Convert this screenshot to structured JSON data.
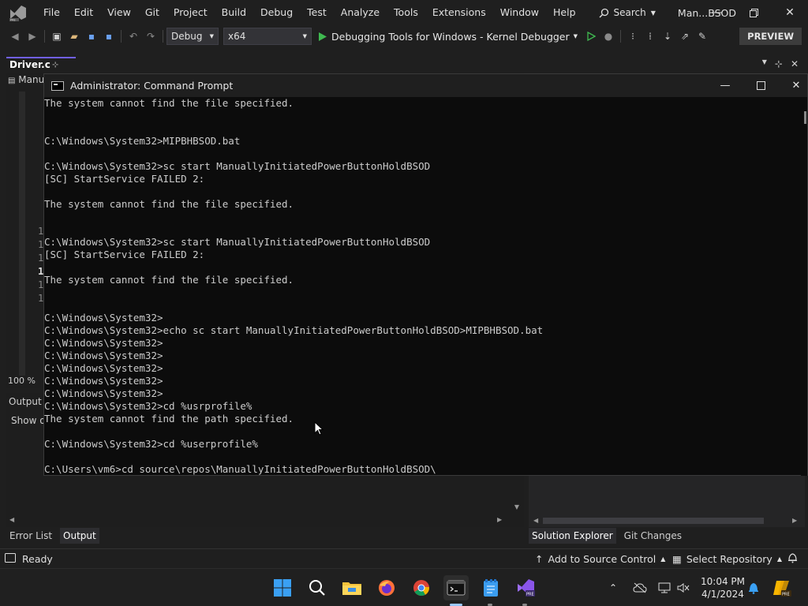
{
  "vs": {
    "menu": [
      "File",
      "Edit",
      "View",
      "Git",
      "Project",
      "Build",
      "Debug",
      "Test",
      "Analyze",
      "Tools",
      "Extensions",
      "Window",
      "Help"
    ],
    "search_label": "Search",
    "title": "Man...BSOD",
    "config": "Debug",
    "platform": "x64",
    "debug_target": "Debugging Tools for Windows - Kernel Debugger",
    "preview_label": "PREVIEW",
    "doc_tab": "Driver.c",
    "doc_subtab": "Manu",
    "line_numbers": [
      "1",
      "1",
      "1",
      "1",
      "1",
      "1"
    ],
    "zoom": "100 %",
    "output_label": "Output",
    "show_label": "Show o",
    "bottom_tabs": [
      "Error List",
      "Output"
    ],
    "right_tabs": [
      "Solution Explorer",
      "Git Changes"
    ]
  },
  "cmd": {
    "title": "Administrator: Command Prompt",
    "lines": [
      "The system cannot find the file specified.",
      "",
      "",
      "C:\\Windows\\System32>MIPBHBSOD.bat",
      "",
      "C:\\Windows\\System32>sc start ManuallyInitiatedPowerButtonHoldBSOD",
      "[SC] StartService FAILED 2:",
      "",
      "The system cannot find the file specified.",
      "",
      "",
      "C:\\Windows\\System32>sc start ManuallyInitiatedPowerButtonHoldBSOD",
      "[SC] StartService FAILED 2:",
      "",
      "The system cannot find the file specified.",
      "",
      "",
      "C:\\Windows\\System32>",
      "C:\\Windows\\System32>echo sc start ManuallyInitiatedPowerButtonHoldBSOD>MIPBHBSOD.bat",
      "C:\\Windows\\System32>",
      "C:\\Windows\\System32>",
      "C:\\Windows\\System32>",
      "C:\\Windows\\System32>",
      "C:\\Windows\\System32>",
      "C:\\Windows\\System32>cd %usrprofile%",
      "The system cannot find the path specified.",
      "",
      "C:\\Windows\\System32>cd %userprofile%",
      "",
      "C:\\Users\\vm6>cd source\\repos\\ManuallyInitiatedPowerButtonHoldBSOD\\"
    ]
  },
  "status": {
    "ready": "Ready",
    "source_control": "Add to Source Control",
    "repository": "Select Repository"
  },
  "taskbar": {
    "time": "10:04 PM",
    "date": "4/1/2024"
  },
  "colors": {
    "accent": "#7160e8",
    "cmd_bg": "#0c0c0c",
    "cmd_text": "#cccccc",
    "play_green": "#3fb950"
  }
}
